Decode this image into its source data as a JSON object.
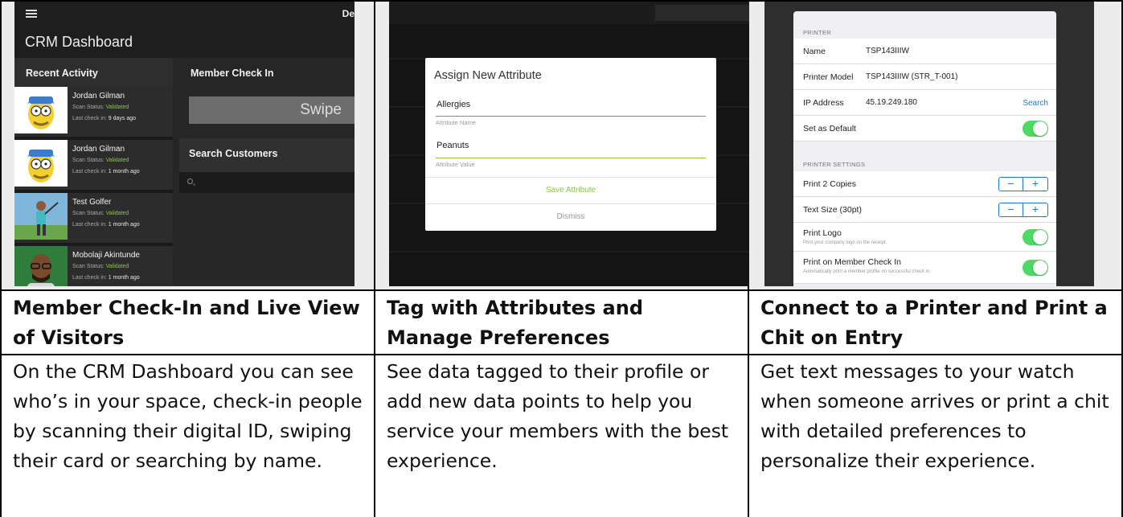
{
  "columns": [
    {
      "title": "Member Check-In and Live View of Visitors",
      "description": "On the CRM Dashboard you can see who’s in your space, check-in people by scanning their digital ID, swiping their card or searching by name."
    },
    {
      "title": "Tag with Attributes and Manage Preferences",
      "description": "See data tagged to their profile or add new data points to help you service your members with the best experience."
    },
    {
      "title": "Connect to a Printer and Print a Chit on Entry",
      "description": "Get text messages to your watch when someone arrives or print a chit with detailed preferences to personalize their experience."
    }
  ],
  "crm": {
    "app_title": "CRM Dashboard",
    "top_right_text": "De",
    "recent_activity_label": "Recent Activity",
    "member_check_in_label": "Member Check In",
    "swipe_label": "Swipe",
    "search_customers_label": "Search Customers",
    "status_prefix": "Scan Status: ",
    "last_prefix": "Last check in: ",
    "activities": [
      {
        "name": "Jordan Gilman",
        "status": "Validated",
        "last": "9 days ago"
      },
      {
        "name": "Jordan Gilman",
        "status": "Validated",
        "last": "1 month ago"
      },
      {
        "name": "Test Golfer",
        "status": "Validated",
        "last": "1 month ago"
      },
      {
        "name": "Mobolaji Akintunde",
        "status": "Validated",
        "last": "1 month ago"
      }
    ]
  },
  "attribute_dialog": {
    "title": "Assign New Attribute",
    "name_value": "Allergies",
    "name_label": "Attribute Name",
    "value_value": "Peanuts",
    "value_label": "Attribute Value",
    "save_label": "Save Attribute",
    "dismiss_label": "Dismiss"
  },
  "printer": {
    "section_printer": "PRINTER",
    "name_label": "Name",
    "name_value": "TSP143IIIW",
    "model_label": "Printer Model",
    "model_value": "TSP143IIIW (STR_T-001)",
    "ip_label": "IP Address",
    "ip_value": "45.19.249.180",
    "search_label": "Search",
    "default_label": "Set as Default",
    "section_settings": "PRINTER SETTINGS",
    "copies_label": "Print 2 Copies",
    "text_size_label": "Text Size (30pt)",
    "logo_label": "Print Logo",
    "logo_sub": "Print your company logo on the receipt",
    "checkin_label": "Print on Member Check In",
    "checkin_sub": "Automatically print a member profile on successful check in",
    "minus": "−",
    "plus": "+"
  }
}
